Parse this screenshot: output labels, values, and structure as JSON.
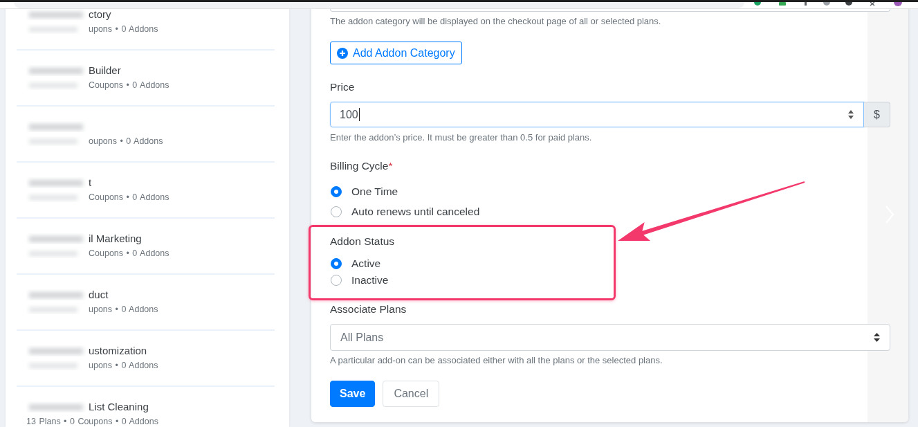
{
  "sidebar": {
    "items": [
      {
        "name": "ctory",
        "name_blurred": true,
        "stats": "upons • 0 Addons",
        "stats_blurred": true
      },
      {
        "name": "Builder",
        "name_blurred": true,
        "stats": "Coupons • 0 Addons",
        "stats_blurred": true
      },
      {
        "name_blurred": true,
        "stats": "oupons • 0 Addons",
        "stats_blurred": true
      },
      {
        "name": "t",
        "name_blurred": true,
        "stats": "Coupons • 0 Addons",
        "stats_blurred": true
      },
      {
        "name": "il Marketing",
        "name_blurred": true,
        "stats": "Coupons • 0 Addons",
        "stats_blurred": true
      },
      {
        "name": "duct",
        "name_blurred": true,
        "stats": "upons • 0 Addons",
        "stats_blurred": true
      },
      {
        "name": "ustomization",
        "name_blurred": true,
        "stats": "upons • 0 Addons",
        "stats_blurred": true
      },
      {
        "name": "List Cleaning",
        "name_blurred": true,
        "stats": "13 Plans • 0 Coupons • 0 Addons",
        "stats_blurred": false
      }
    ]
  },
  "form": {
    "category_help": "The addon category will be displayed on the checkout page of all or selected plans.",
    "add_category_button": "Add Addon Category",
    "price": {
      "label": "Price",
      "value": "100",
      "focused": true,
      "currency": "$",
      "help": "Enter the addon’s price. It must be greater than 0.5 for paid plans."
    },
    "billing_cycle": {
      "label": "Billing Cycle",
      "required_mark": "*",
      "options": [
        {
          "label": "One Time",
          "selected": true
        },
        {
          "label": "Auto renews until canceled",
          "selected": false
        }
      ]
    },
    "addon_status": {
      "label": "Addon Status",
      "highlighted": true,
      "options": [
        {
          "label": "Active",
          "selected": true
        },
        {
          "label": "Inactive",
          "selected": false
        }
      ]
    },
    "associate_plans": {
      "label": "Associate Plans",
      "value": "All Plans",
      "help": "A particular add-on can be associated either with all the plans or the selected plans."
    },
    "buttons": [
      {
        "label": "Save",
        "kind": "primary"
      },
      {
        "label": "Cancel",
        "kind": "secondary"
      }
    ]
  }
}
